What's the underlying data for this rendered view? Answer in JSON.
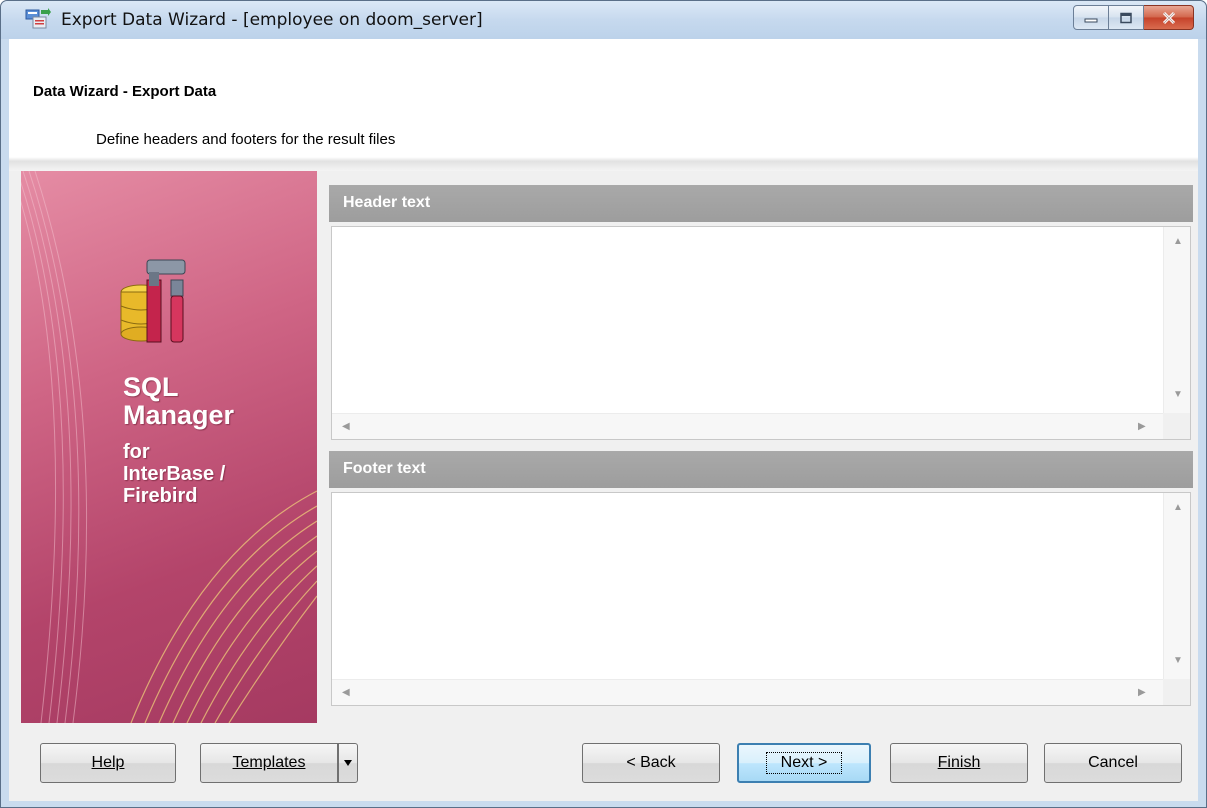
{
  "window": {
    "title": "Export Data Wizard - [employee on doom_server]",
    "caption_buttons": {
      "minimize_icon": "minimize-icon",
      "maximize_icon": "maximize-icon",
      "close_icon": "close-icon"
    }
  },
  "header": {
    "title": "Data Wizard - Export Data",
    "subtitle": "Define headers and footers for the result files"
  },
  "banner": {
    "line1": "SQL",
    "line2": "Manager",
    "line3": "for",
    "line4": "InterBase /",
    "line5": "Firebird",
    "logo_icon": "database-tools-icon"
  },
  "panels": {
    "header_label": "Header text",
    "header_value": "",
    "footer_label": "Footer text",
    "footer_value": ""
  },
  "buttons": {
    "help": "Help",
    "templates": "Templates",
    "back": "< Back",
    "next": "Next >",
    "finish": "Finish",
    "cancel": "Cancel"
  },
  "colors": {
    "banner_accent": "#c95a7e",
    "panel_header": "#a3a3a3",
    "default_button_border": "#3c7fb1"
  }
}
